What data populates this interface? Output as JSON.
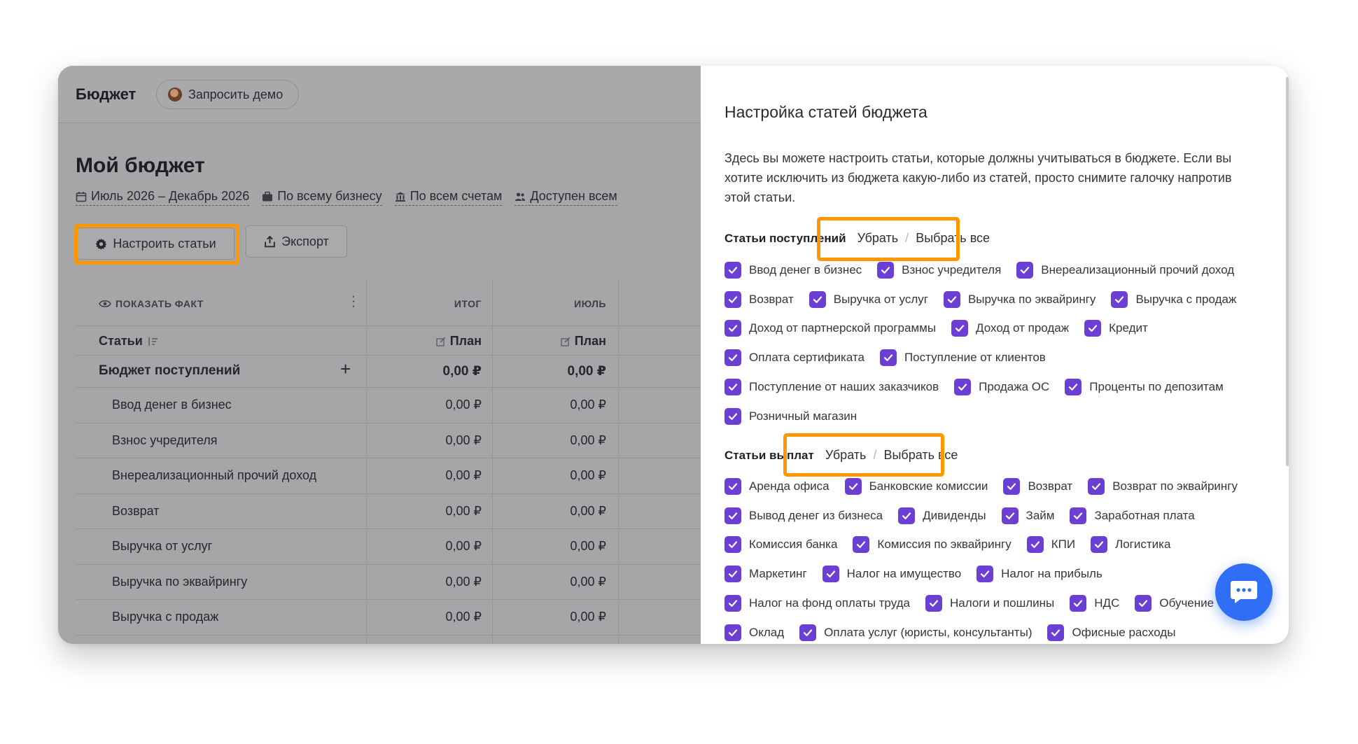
{
  "app": {
    "title": "Бюджет",
    "demo_label": "Запросить демо",
    "page_title": "Мой бюджет",
    "filters": [
      "Июль 2026 – Декабрь 2026",
      "По всему бизнесу",
      "По всем счетам",
      "Доступен всем"
    ],
    "setup_label": "Настроить статьи",
    "export_label": "Экспорт"
  },
  "table": {
    "show_fact": "ПОКАЗАТЬ ФАКТ",
    "col_total": "ИТОГ",
    "col_month": "ИЮЛЬ",
    "articles_label": "Статьи",
    "plan_label": "План",
    "group_label": "Бюджет поступлений",
    "group_total": "0,00 ₽",
    "group_month": "0,00 ₽",
    "rows": [
      {
        "name": "Ввод денег в бизнес",
        "total": "0,00 ₽",
        "month": "0,00 ₽"
      },
      {
        "name": "Взнос учредителя",
        "total": "0,00 ₽",
        "month": "0,00 ₽"
      },
      {
        "name": "Внереализационный прочий доход",
        "total": "0,00 ₽",
        "month": "0,00 ₽"
      },
      {
        "name": "Возврат",
        "total": "0,00 ₽",
        "month": "0,00 ₽"
      },
      {
        "name": "Выручка от услуг",
        "total": "0,00 ₽",
        "month": "0,00 ₽"
      },
      {
        "name": "Выручка по эквайрингу",
        "total": "0,00 ₽",
        "month": "0,00 ₽"
      },
      {
        "name": "Выручка с продаж",
        "total": "0,00 ₽",
        "month": "0,00 ₽"
      }
    ]
  },
  "drawer": {
    "title": "Настройка статей бюджета",
    "description": "Здесь вы можете настроить статьи, которые должны учитываться в бюджете. Если вы хотите исключить из бюджета какую-либо из статей, просто снимите галочку напротив этой статьи.",
    "income": {
      "label": "Статьи поступлений",
      "remove": "Убрать",
      "select_all": "Выбрать все",
      "items": [
        "Ввод денег в бизнес",
        "Взнос учредителя",
        "Внереализационный прочий доход",
        "Возврат",
        "Выручка от услуг",
        "Выручка по эквайрингу",
        "Выручка с продаж",
        "Доход от партнерской программы",
        "Доход от продаж",
        "Кредит",
        "Оплата сертификата",
        "Поступление от клиентов",
        "Поступление от наших заказчиков",
        "Продажа ОС",
        "Проценты по депозитам",
        "Розничный магазин"
      ]
    },
    "expense": {
      "label": "Статьи выплат",
      "remove": "Убрать",
      "select_all": "Выбрать все",
      "items": [
        "Аренда офиса",
        "Банковские комиссии",
        "Возврат",
        "Возврат по эквайрингу",
        "Вывод денег из бизнеса",
        "Дивиденды",
        "Займ",
        "Заработная плата",
        "Комиссия банка",
        "Комиссия по эквайрингу",
        "КПИ",
        "Логистика",
        "Маркетинг",
        "Налог на имущество",
        "Налог на прибыль",
        "Налог на фонд оплаты труда",
        "Налоги и пошлины",
        "НДС",
        "Обучение",
        "Оклад",
        "Оплата услуг (юристы, консультанты)",
        "Офисные расходы"
      ]
    }
  },
  "colors": {
    "accent": "#6c3fd4",
    "highlight": "#ff9800",
    "chat": "#2f6ef5"
  },
  "icons": [
    "calendar-icon",
    "briefcase-icon",
    "bank-icon",
    "users-icon",
    "gear-icon",
    "export-icon",
    "eye-icon",
    "more-icon",
    "sort-icon",
    "edit-icon",
    "plus-icon",
    "check-icon",
    "chat-icon"
  ]
}
